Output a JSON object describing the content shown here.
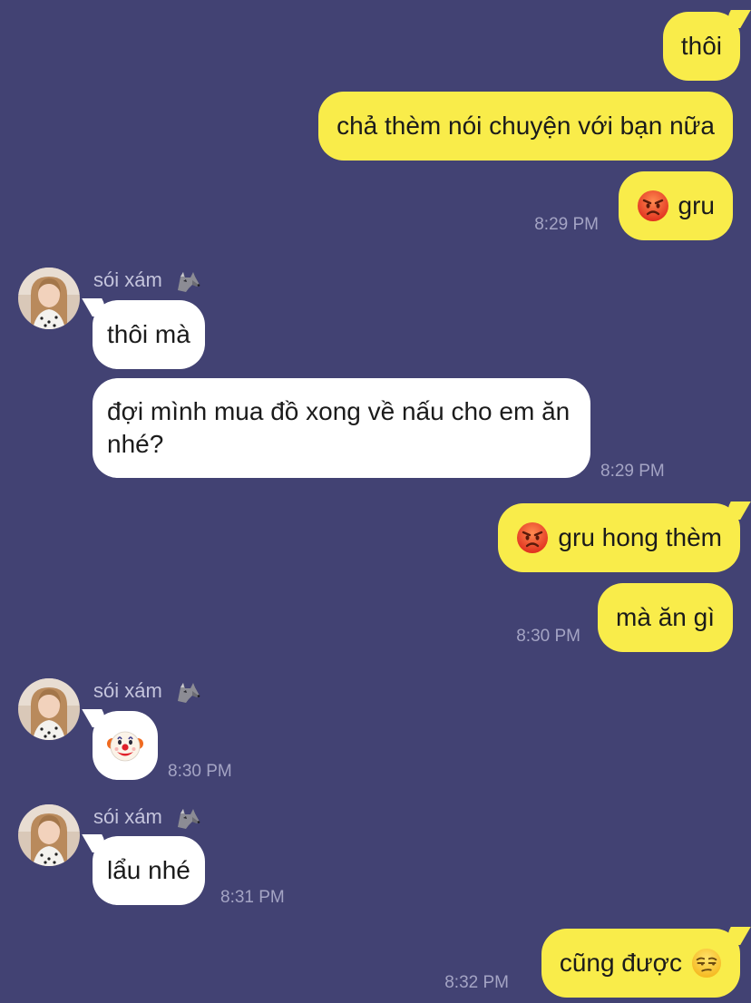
{
  "colors": {
    "background": "#424273",
    "outgoing_bubble": "#f9ec4a",
    "incoming_bubble": "#ffffff",
    "timestamp": "#a4a4c4",
    "sender_name": "#c4c4dc"
  },
  "messages": {
    "out1": {
      "text": "thôi"
    },
    "out2": {
      "text": "chả thèm nói chuyện với bạn nữa"
    },
    "out3": {
      "emoji": "angry-face-icon",
      "text": "gru",
      "time": "8:29 PM"
    },
    "group1": {
      "sender": "sói xám",
      "sender_emoji": "wolf-icon",
      "in1": {
        "text": "thôi mà"
      },
      "in2": {
        "text": "đợi mình mua đồ xong về nấu cho em ăn nhé?",
        "time": "8:29 PM"
      }
    },
    "out4": {
      "emoji": "angry-face-icon",
      "text": "gru hong thèm"
    },
    "out5": {
      "text": "mà ăn gì",
      "time": "8:30 PM"
    },
    "group2": {
      "sender": "sói xám",
      "sender_emoji": "wolf-icon",
      "in1": {
        "emoji": "clown-face-icon",
        "time": "8:30 PM"
      }
    },
    "group3": {
      "sender": "sói xám",
      "sender_emoji": "wolf-icon",
      "in1": {
        "text": "lẩu nhé",
        "time": "8:31 PM"
      }
    },
    "out6": {
      "text": "cũng được",
      "emoji": "unamused-face-icon",
      "time": "8:32 PM"
    }
  }
}
